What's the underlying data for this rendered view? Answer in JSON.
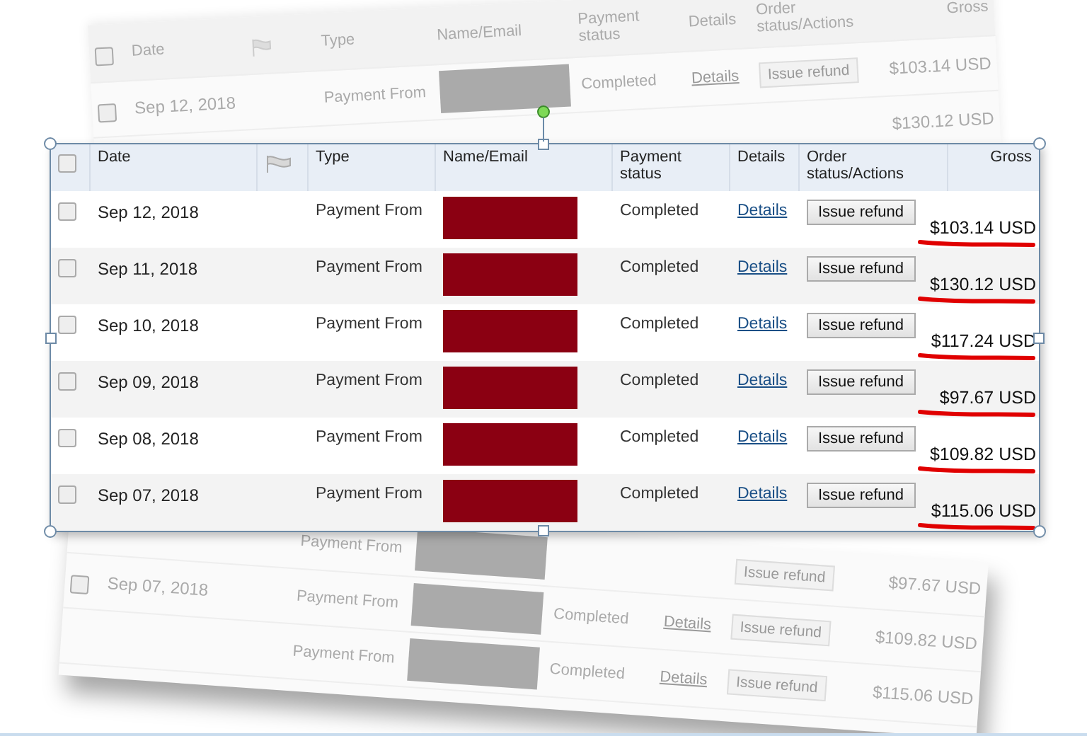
{
  "background_sheet": {
    "columns": [
      {
        "kind": "checkbox",
        "checked": false
      },
      {
        "kind": "text",
        "label": "Date"
      },
      {
        "kind": "flag"
      },
      {
        "kind": "text",
        "label": "Type"
      },
      {
        "kind": "text",
        "label": "Name/Email"
      },
      {
        "kind": "text",
        "label": "Payment status"
      },
      {
        "kind": "text",
        "label": "Details"
      },
      {
        "kind": "text",
        "label": "Order status/Actions"
      },
      {
        "kind": "text",
        "label": "Gross"
      }
    ],
    "top_rows": [
      {
        "checked": false,
        "date": "Sep 12, 2018",
        "type": "Payment From",
        "redacted": true,
        "status": "Completed",
        "details": "Details",
        "action": "Issue refund",
        "gross": "$103.14 USD"
      },
      {
        "gross": "$130.12 USD"
      }
    ],
    "bottom_rows": [
      {
        "type": "Payment From",
        "redacted": true,
        "action": "Issue refund",
        "gross": "$97.67 USD"
      },
      {
        "checked": false,
        "date": "Sep 07, 2018",
        "type": "Payment From",
        "redacted": true,
        "status": "Completed",
        "details": "Details",
        "action": "Issue refund",
        "gross": "$109.82 USD"
      },
      {
        "type": "Payment From",
        "redacted": true,
        "status": "Completed",
        "details": "Details",
        "action": "Issue refund",
        "gross": "$115.06 USD"
      }
    ]
  },
  "table": {
    "columns": [
      {
        "kind": "checkbox",
        "checked": false
      },
      {
        "kind": "text",
        "label": "Date"
      },
      {
        "kind": "flag"
      },
      {
        "kind": "text",
        "label": "Type"
      },
      {
        "kind": "text",
        "label": "Name/Email"
      },
      {
        "kind": "text",
        "label": "Payment status"
      },
      {
        "kind": "text",
        "label": "Details"
      },
      {
        "kind": "text",
        "label": "Order status/Actions"
      },
      {
        "kind": "text",
        "label": "Gross"
      }
    ],
    "rows": [
      {
        "checked": false,
        "date": "Sep 12, 2018",
        "type": "Payment From",
        "redacted": true,
        "status": "Completed",
        "details": "Details",
        "action": "Issue refund",
        "gross": "$103.14 USD",
        "underlined": true
      },
      {
        "checked": false,
        "date": "Sep 11, 2018",
        "type": "Payment From",
        "redacted": true,
        "status": "Completed",
        "details": "Details",
        "action": "Issue refund",
        "gross": "$130.12 USD",
        "underlined": true
      },
      {
        "checked": false,
        "date": "Sep 10, 2018",
        "type": "Payment From",
        "redacted": true,
        "status": "Completed",
        "details": "Details",
        "action": "Issue refund",
        "gross": "$117.24 USD",
        "underlined": true
      },
      {
        "checked": false,
        "date": "Sep 09, 2018",
        "type": "Payment From",
        "redacted": true,
        "status": "Completed",
        "details": "Details",
        "action": "Issue refund",
        "gross": "$97.67 USD",
        "underlined": true
      },
      {
        "checked": false,
        "date": "Sep 08, 2018",
        "type": "Payment From",
        "redacted": true,
        "status": "Completed",
        "details": "Details",
        "action": "Issue refund",
        "gross": "$109.82 USD",
        "underlined": true
      },
      {
        "checked": false,
        "date": "Sep 07, 2018",
        "type": "Payment From",
        "redacted": true,
        "status": "Completed",
        "details": "Details",
        "action": "Issue refund",
        "gross": "$115.06 USD",
        "underlined": true
      }
    ]
  }
}
